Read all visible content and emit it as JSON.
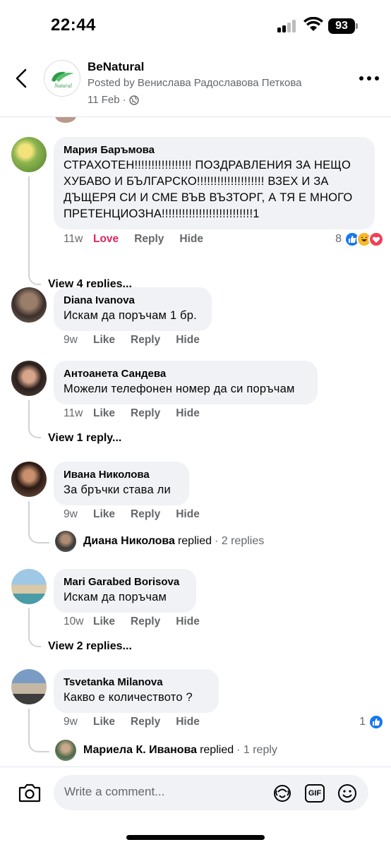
{
  "status_bar": {
    "time": "22:44",
    "battery": "93"
  },
  "header": {
    "page_name": "BeNatural",
    "posted_by": "Posted by Венислава Радославова Петкова",
    "date": "11 Feb",
    "date_separator": "·",
    "logo_text": "Natural"
  },
  "comments": [
    {
      "author": "Мария Баръмова",
      "text": "СТРАХОТЕН!!!!!!!!!!!!!!!!!  ПОЗДРАВЛЕНИЯ  ЗА  НЕЩО ХУБАВО И БЪЛГАРСКО!!!!!!!!!!!!!!!!!!!! ВЗЕХ И ЗА ДЪЩЕРЯ СИ И СМЕ ВЪВ ВЪЗТОРГ,  А ТЯ Е МНОГО ПРЕТЕНЦИОЗНА!!!!!!!!!!!!!!!!!!!!!!!!!!!1",
      "time": "11w",
      "action1": "Love",
      "action2": "Reply",
      "action3": "Hide",
      "reaction_count": "8",
      "view_replies": "View 4 replies..."
    },
    {
      "author": "Diana Ivanova",
      "text": "Искам да поръчам 1 бр.",
      "time": "9w",
      "action1": "Like",
      "action2": "Reply",
      "action3": "Hide"
    },
    {
      "author": "Антоанета Сандева",
      "text": "Можели телефонен номер да си поръчам",
      "time": "11w",
      "action1": "Like",
      "action2": "Reply",
      "action3": "Hide",
      "view_replies": "View 1 reply..."
    },
    {
      "author": "Ивана Николова",
      "text": "За бръчки става ли",
      "time": "9w",
      "action1": "Like",
      "action2": "Reply",
      "action3": "Hide",
      "reply_author": "Диана Николова",
      "reply_verb": "replied",
      "reply_count": "· 2 replies"
    },
    {
      "author": "Mari Garabed Borisova",
      "text": "Искам да поръчам",
      "time": "10w",
      "action1": "Like",
      "action2": "Reply",
      "action3": "Hide",
      "view_replies": "View 2 replies..."
    },
    {
      "author": "Tsvetanka Milanova",
      "text": "Какво е количеството ?",
      "time": "9w",
      "action1": "Like",
      "action2": "Reply",
      "action3": "Hide",
      "reaction_count": "1",
      "reply_author": "Мариела К. Иванова",
      "reply_verb": "replied",
      "reply_count": "· 1 reply"
    }
  ],
  "composer": {
    "placeholder": "Write a comment...",
    "gif_label": "GIF"
  },
  "colors": {
    "accent_blue": "#1877f2",
    "love_red": "#e0245e",
    "bubble_bg": "#f0f2f5",
    "muted": "#65676b"
  },
  "icons": [
    "back-icon",
    "more-icon",
    "globe-icon",
    "camera-icon",
    "avatar-sticker-icon",
    "gif-icon",
    "emoji-icon",
    "like-reaction-icon",
    "haha-reaction-icon",
    "love-reaction-icon"
  ]
}
